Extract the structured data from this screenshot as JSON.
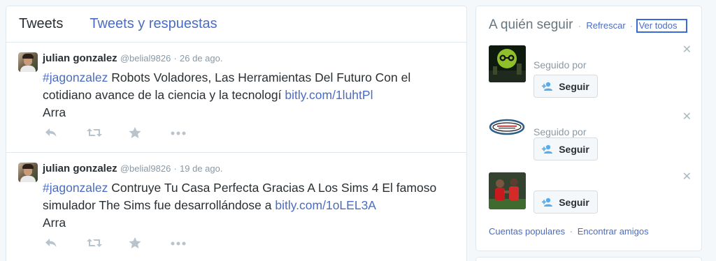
{
  "tabs": [
    {
      "label": "Tweets"
    },
    {
      "label": "Tweets y respuestas"
    }
  ],
  "tweets": [
    {
      "fullname": "julian gonzalez",
      "handle": "@belial9826",
      "sep": "·",
      "time": "26 de ago.",
      "hashtag": "#jagonzalez",
      "text_line1": " Robots Voladores, Las Herramientas Del Futuro Con el",
      "text_line2": "cotidiano avance de la ciencia y la tecnologí ",
      "url": "bitly.com/1luhtPl",
      "text_line3": " Arra"
    },
    {
      "fullname": "julian gonzalez",
      "handle": "@belial9826",
      "sep": "·",
      "time": "19 de ago.",
      "hashtag": "#jagonzalez",
      "text_line1": " Contruye Tu Casa Perfecta Gracias A Los Sims 4 El famoso",
      "text_line2": "simulador The Sims fue desarrollándose a  ",
      "url": "bitly.com/1oLEL3A",
      "text_line3": " Arra"
    }
  ],
  "who_to_follow": {
    "title": "A quién seguir",
    "dot": "·",
    "refresh": "Refrescar",
    "view_all": "Ver todos",
    "suggestions": [
      {
        "followed_by": "Seguido por",
        "button": "Seguir"
      },
      {
        "followed_by": "Seguido por",
        "button": "Seguir"
      },
      {
        "followed_by": "",
        "button": "Seguir"
      }
    ],
    "footer_popular": "Cuentas populares",
    "footer_dot": "·",
    "footer_friends": "Encontrar amigos"
  },
  "colors": {
    "link": "#4a6cc5",
    "muted": "#8899a6",
    "icon": "#b8c3cb"
  }
}
